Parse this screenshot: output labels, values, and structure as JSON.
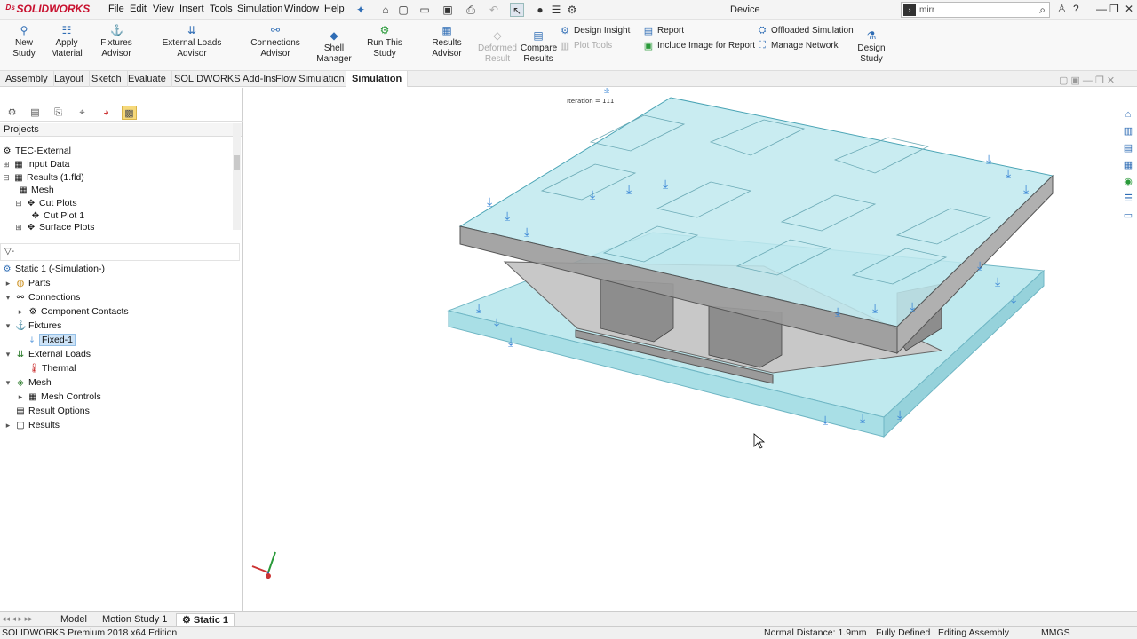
{
  "app": {
    "brand": "SOLIDWORKS",
    "doc_title": "Device"
  },
  "menu": [
    "File",
    "Edit",
    "View",
    "Insert",
    "Tools",
    "Simulation",
    "Window",
    "Help"
  ],
  "search": {
    "value": "mirr"
  },
  "ribbon": {
    "new_study": "New Study",
    "apply_material": "Apply\nMaterial",
    "fixtures_advisor": "Fixtures Advisor",
    "external_loads_advisor": "External Loads Advisor",
    "connections_advisor": "Connections Advisor",
    "shell_manager": "Shell\nManager",
    "run_this_study": "Run This Study",
    "results_advisor": "Results Advisor",
    "deformed_result": "Deformed\nResult",
    "compare_results": "Compare\nResults",
    "design_insight": "Design Insight",
    "plot_tools": "Plot Tools",
    "report": "Report",
    "include_image": "Include Image for Report",
    "offloaded_simulation": "Offloaded Simulation",
    "manage_network": "Manage Network",
    "design_study": "Design\nStudy"
  },
  "cmd_tabs": [
    "Assembly",
    "Layout",
    "Sketch",
    "Evaluate",
    "SOLIDWORKS Add-Ins",
    "Flow Simulation",
    "Simulation"
  ],
  "flow_tree": {
    "header": "Projects",
    "items": [
      {
        "label": "TEC-External"
      },
      {
        "label": "Input Data"
      },
      {
        "label": "Results (1.fld)"
      },
      {
        "label": "Mesh"
      },
      {
        "label": "Cut Plots"
      },
      {
        "label": "Cut Plot 1"
      },
      {
        "label": "Surface Plots"
      }
    ]
  },
  "filter": {
    "label": "▽-"
  },
  "sim_tree": {
    "root": "Static 1 (-Simulation-)",
    "items": [
      {
        "label": "Parts"
      },
      {
        "label": "Connections"
      },
      {
        "label": "Component Contacts"
      },
      {
        "label": "Fixtures"
      },
      {
        "label": "Fixed-1"
      },
      {
        "label": "External Loads"
      },
      {
        "label": "Thermal"
      },
      {
        "label": "Mesh"
      },
      {
        "label": "Mesh Controls"
      },
      {
        "label": "Result Options"
      },
      {
        "label": "Results"
      }
    ]
  },
  "viewport": {
    "iteration_label": "Iteration = 111"
  },
  "bottom_tabs": [
    "Model",
    "Motion Study 1",
    "Static 1"
  ],
  "status": {
    "edition": "SOLIDWORKS Premium 2018 x64 Edition",
    "normal_distance": "Normal Distance: 1.9mm",
    "fully_defined": "Fully Defined",
    "editing": "Editing Assembly",
    "units": "MMGS"
  },
  "colors": {
    "accent": "#2f6db5",
    "fixture": "#3a86d6",
    "plate": "#bfe9ee",
    "brand": "#c8102e"
  }
}
